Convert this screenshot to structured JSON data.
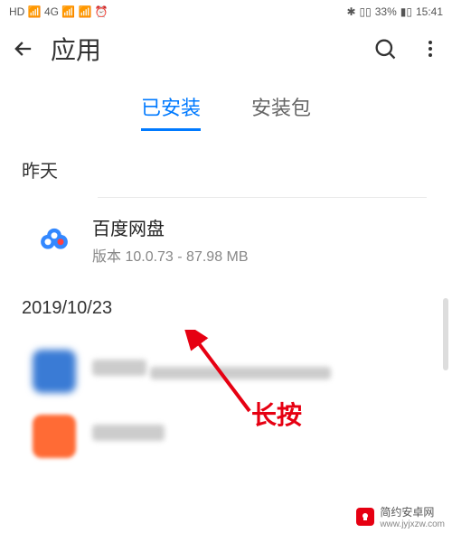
{
  "status_bar": {
    "left_indicators": "HD 📶 4G 📶 📶 ⏰",
    "bluetooth": "✱",
    "vibrate": "▯▯",
    "battery_pct": "33%",
    "battery_icon": "▮▯",
    "time": "15:41"
  },
  "header": {
    "title": "应用"
  },
  "tabs": {
    "installed": "已安装",
    "packages": "安装包"
  },
  "sections": {
    "yesterday": "昨天",
    "date1": "2019/10/23"
  },
  "apps": {
    "baidu": {
      "name": "百度网盘",
      "meta": "版本 10.0.73 - 87.98 MB"
    }
  },
  "annotation": {
    "label": "长按"
  },
  "watermark": {
    "name": "简约安卓网",
    "url": "www.jyjxzw.com"
  }
}
